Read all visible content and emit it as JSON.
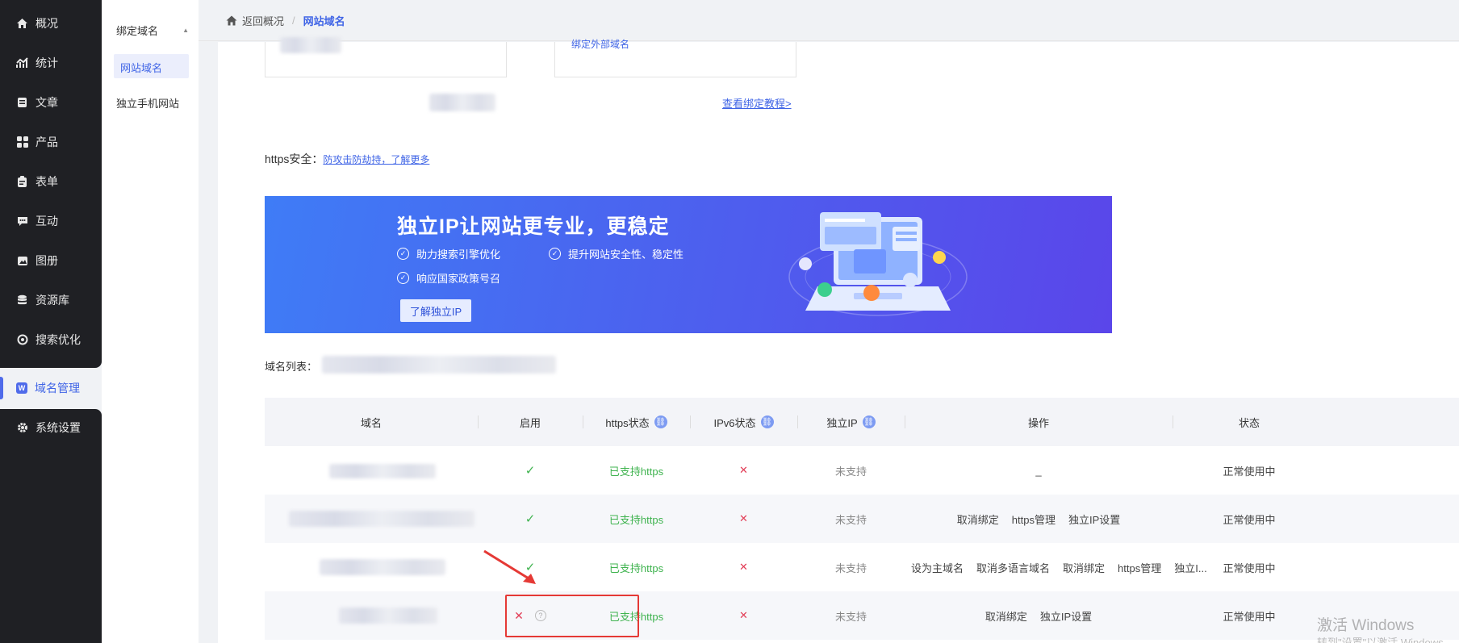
{
  "nav": {
    "items": [
      {
        "label": "概况",
        "icon": "home-icon"
      },
      {
        "label": "统计",
        "icon": "chart-icon"
      },
      {
        "label": "文章",
        "icon": "article-icon"
      },
      {
        "label": "产品",
        "icon": "product-icon"
      },
      {
        "label": "表单",
        "icon": "form-icon"
      },
      {
        "label": "互动",
        "icon": "chat-icon"
      },
      {
        "label": "图册",
        "icon": "album-icon"
      },
      {
        "label": "资源库",
        "icon": "database-icon"
      },
      {
        "label": "搜索优化",
        "icon": "seo-icon"
      },
      {
        "label": "域名管理",
        "icon": "domain-icon",
        "badge": "W"
      },
      {
        "label": "系统设置",
        "icon": "gear-icon"
      }
    ]
  },
  "subnav": {
    "group_label": "绑定域名",
    "active_label": "网站域名",
    "item_label": "独立手机网站"
  },
  "breadcrumb": {
    "back_label": "返回概况",
    "sep": "/",
    "current": "网站域名"
  },
  "bind": {
    "ext_label": "绑定外部域名",
    "tutorial_link": "查看绑定教程>"
  },
  "https": {
    "label": "https安全：",
    "link": "防攻击防劫持，了解更多"
  },
  "banner": {
    "title": "独立IP让网站更专业，更稳定",
    "feature1": "助力搜索引擎优化",
    "feature2": "提升网站安全性、稳定性",
    "feature3": "响应国家政策号召",
    "button": "了解独立IP"
  },
  "domain_list": {
    "label": "域名列表："
  },
  "table": {
    "headers": {
      "domain": "域名",
      "enabled": "启用",
      "https": "https状态",
      "ipv6": "IPv6状态",
      "ip": "独立IP",
      "ops": "操作",
      "status": "状态"
    },
    "rows": [
      {
        "enabled": "✓",
        "https": "已支持https",
        "ipv6": "✕",
        "ip": "未支持",
        "ops": [
          "_"
        ],
        "status": "正常使用中"
      },
      {
        "enabled": "✓",
        "https": "已支持https",
        "ipv6": "✕",
        "ip": "未支持",
        "ops": [
          "取消绑定",
          "https管理",
          "独立IP设置"
        ],
        "status": "正常使用中"
      },
      {
        "enabled": "✓",
        "https": "已支持https",
        "ipv6": "✕",
        "ip": "未支持",
        "ops": [
          "设为主域名",
          "取消多语言域名",
          "取消绑定",
          "https管理",
          "独立I..."
        ],
        "status": "正常使用中"
      },
      {
        "enabled": "✕",
        "https": "已支持https",
        "ipv6": "✕",
        "ip": "未支持",
        "ops": [
          "取消绑定",
          "独立IP设置"
        ],
        "status": "正常使用中"
      }
    ],
    "help": "?"
  },
  "watermark": {
    "line1": "激活 Windows",
    "line2": "转到\"设置\"以激活 Windows"
  },
  "colors": {
    "nav_bg": "#1f2024",
    "accent": "#3f64e6",
    "success": "#3fb34f",
    "danger": "#e23e57",
    "highlight": "#e53935"
  }
}
